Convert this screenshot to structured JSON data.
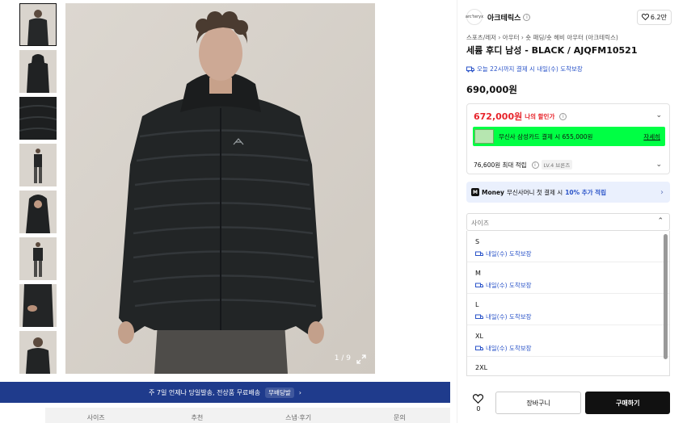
{
  "gallery": {
    "counter": "1 / 9",
    "thumb_count": 8
  },
  "banner": {
    "text": "주 7일 언제나 당일발송, 전상품 무료배송",
    "badge": "무배당발",
    "arrow": "›"
  },
  "tabs": [
    "",
    "사이즈",
    "추천",
    "스냅·후기",
    "문의"
  ],
  "brand": {
    "logo_text": "arc'teryx",
    "name": "아크테릭스",
    "likes": "6.2만"
  },
  "breadcrumb": "스포츠/레저 › 아우터 › 숏 패딩/숏 헤비 아우터 (아크테릭스)",
  "product": {
    "title": "세륨 후디 남성 - BLACK / AJQFM10521",
    "delivery": "오늘 22시까지 결제 시 내일(수) 도착보장",
    "price": "690,000원"
  },
  "discount": {
    "price": "672,000원",
    "label": "나의 할인가",
    "card_text": "무신사 삼성카드 결제 시 655,000원",
    "card_detail": "자세히",
    "points": "76,600원 최대 적립",
    "level": "LV.4 브론즈"
  },
  "money": {
    "brand": "Money",
    "text": "무신사머니 첫 결제 시",
    "highlight": "10% 추가 적립"
  },
  "size_select": {
    "placeholder": "사이즈",
    "items": [
      {
        "name": "S",
        "delivery": "내일(수) 도착보장"
      },
      {
        "name": "M",
        "delivery": "내일(수) 도착보장"
      },
      {
        "name": "L",
        "delivery": "내일(수) 도착보장"
      },
      {
        "name": "XL",
        "delivery": "내일(수) 도착보장"
      },
      {
        "name": "2XL",
        "delivery": ""
      }
    ]
  },
  "actions": {
    "like_count": "0",
    "cart": "장바구니",
    "buy": "구매하기"
  },
  "colors": {
    "accent_blue": "#2a53c8",
    "discount_red": "#e7242b",
    "banner_navy": "#1f3b8c",
    "card_green": "#00ff44"
  }
}
